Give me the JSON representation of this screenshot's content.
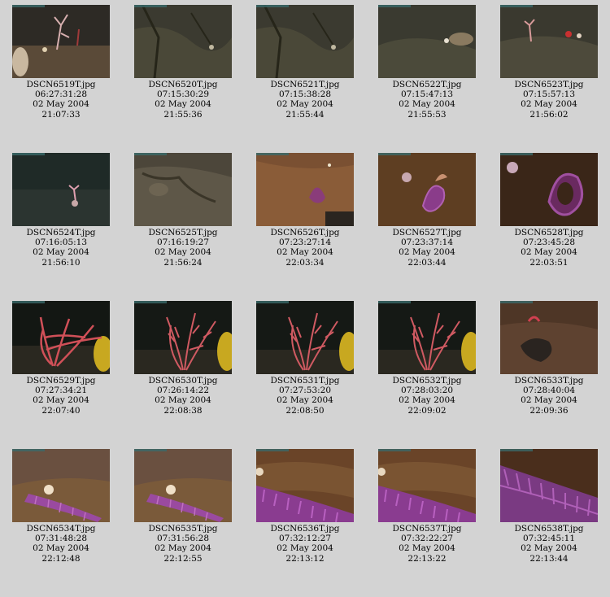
{
  "thumbnails": [
    {
      "filename": "DSCN6519T.jpg",
      "timecode": "06:27:31:28",
      "date": "02 May 2004",
      "time": "21:07:33",
      "scene": "sparse-coral-left"
    },
    {
      "filename": "DSCN6520T.jpg",
      "timecode": "07:15:30:29",
      "date": "02 May 2004",
      "time": "21:55:36",
      "scene": "rock"
    },
    {
      "filename": "DSCN6521T.jpg",
      "timecode": "07:15:38:28",
      "date": "02 May 2004",
      "time": "21:55:44",
      "scene": "rock"
    },
    {
      "filename": "DSCN6522T.jpg",
      "timecode": "07:15:47:13",
      "date": "02 May 2004",
      "time": "21:55:53",
      "scene": "rock-shell"
    },
    {
      "filename": "DSCN6523T.jpg",
      "timecode": "07:15:57:13",
      "date": "02 May 2004",
      "time": "21:56:02",
      "scene": "rock-small-coral"
    },
    {
      "filename": "DSCN6524T.jpg",
      "timecode": "07:16:05:13",
      "date": "02 May 2004",
      "time": "21:56:10",
      "scene": "dark-small-coral"
    },
    {
      "filename": "DSCN6525T.jpg",
      "timecode": "07:16:19:27",
      "date": "02 May 2004",
      "time": "21:56:24",
      "scene": "sediment-rock"
    },
    {
      "filename": "DSCN6526T.jpg",
      "timecode": "07:23:27:14",
      "date": "02 May 2004",
      "time": "22:03:34",
      "scene": "orange-sediment-purple"
    },
    {
      "filename": "DSCN6527T.jpg",
      "timecode": "07:23:37:14",
      "date": "02 May 2004",
      "time": "22:03:44",
      "scene": "brown-purple-coral"
    },
    {
      "filename": "DSCN6528T.jpg",
      "timecode": "07:23:45:28",
      "date": "02 May 2004",
      "time": "22:03:51",
      "scene": "dark-purple-coral"
    },
    {
      "filename": "DSCN6529T.jpg",
      "timecode": "07:27:34:21",
      "date": "02 May 2004",
      "time": "22:07:40",
      "scene": "red-fan"
    },
    {
      "filename": "DSCN6530T.jpg",
      "timecode": "07:26:14:22",
      "date": "02 May 2004",
      "time": "22:08:38",
      "scene": "red-fan-open"
    },
    {
      "filename": "DSCN6531T.jpg",
      "timecode": "07:27:53:20",
      "date": "02 May 2004",
      "time": "22:08:50",
      "scene": "red-fan-open"
    },
    {
      "filename": "DSCN6532T.jpg",
      "timecode": "07:28:03:20",
      "date": "02 May 2004",
      "time": "22:09:02",
      "scene": "red-fan-open"
    },
    {
      "filename": "DSCN6533T.jpg",
      "timecode": "07:28:40:04",
      "date": "02 May 2004",
      "time": "22:09:36",
      "scene": "brown-debris"
    },
    {
      "filename": "DSCN6534T.jpg",
      "timecode": "07:31:48:28",
      "date": "02 May 2004",
      "time": "22:12:48",
      "scene": "purple-log-light"
    },
    {
      "filename": "DSCN6535T.jpg",
      "timecode": "07:31:56:28",
      "date": "02 May 2004",
      "time": "22:12:55",
      "scene": "purple-log-light"
    },
    {
      "filename": "DSCN6536T.jpg",
      "timecode": "07:32:12:27",
      "date": "02 May 2004",
      "time": "22:13:12",
      "scene": "purple-log-close"
    },
    {
      "filename": "DSCN6537T.jpg",
      "timecode": "07:32:22:27",
      "date": "02 May 2004",
      "time": "22:13:22",
      "scene": "purple-log-close"
    },
    {
      "filename": "DSCN6538T.jpg",
      "timecode": "07:32:45:11",
      "date": "02 May 2004",
      "time": "22:13:44",
      "scene": "purple-log-dense"
    }
  ]
}
